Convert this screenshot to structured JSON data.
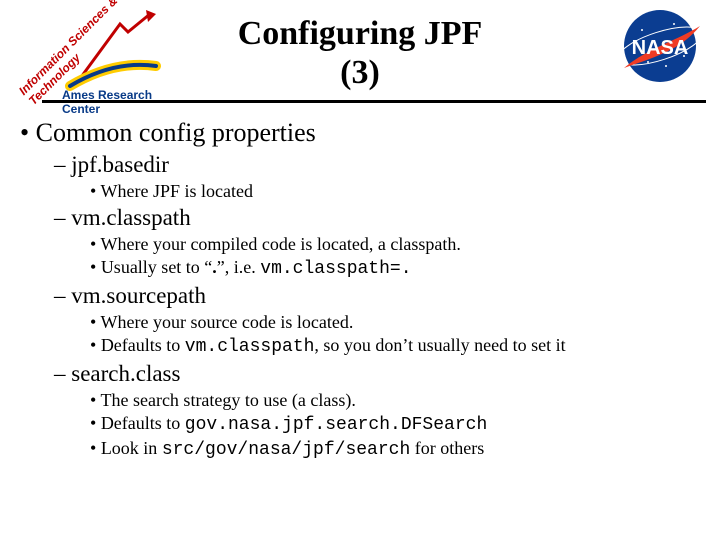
{
  "title_line1": "Configuring JPF",
  "title_line2": "(3)",
  "logos": {
    "left_top_text": "Information Sciences & Technology",
    "left_bottom_text": "Ames Research Center",
    "right_text": "NASA"
  },
  "bullet_main": "Common config properties",
  "items": [
    {
      "name": "jpf.basedir",
      "details": [
        {
          "text": "Where JPF is located"
        }
      ]
    },
    {
      "name": "vm.classpath",
      "details": [
        {
          "text": "Where your compiled code is located, a classpath."
        },
        {
          "prefix": "Usually set to “",
          "bold1": ".",
          "mid": "”, i.e. ",
          "code1": "vm.classpath=."
        }
      ]
    },
    {
      "name": "vm.sourcepath",
      "details": [
        {
          "text": "Where your source code is located."
        },
        {
          "prefix": "Defaults to ",
          "code1": "vm.classpath",
          "suffix": ", so you don’t usually need to set it"
        }
      ]
    },
    {
      "name": "search.class",
      "details": [
        {
          "text": "The search strategy to use (a class)."
        },
        {
          "prefix": "Defaults to ",
          "code1": "gov.nasa.jpf.search.DFSearch"
        },
        {
          "prefix": "Look in ",
          "code1": "src/gov/nasa/jpf/search",
          "suffix": " for others"
        }
      ]
    }
  ]
}
